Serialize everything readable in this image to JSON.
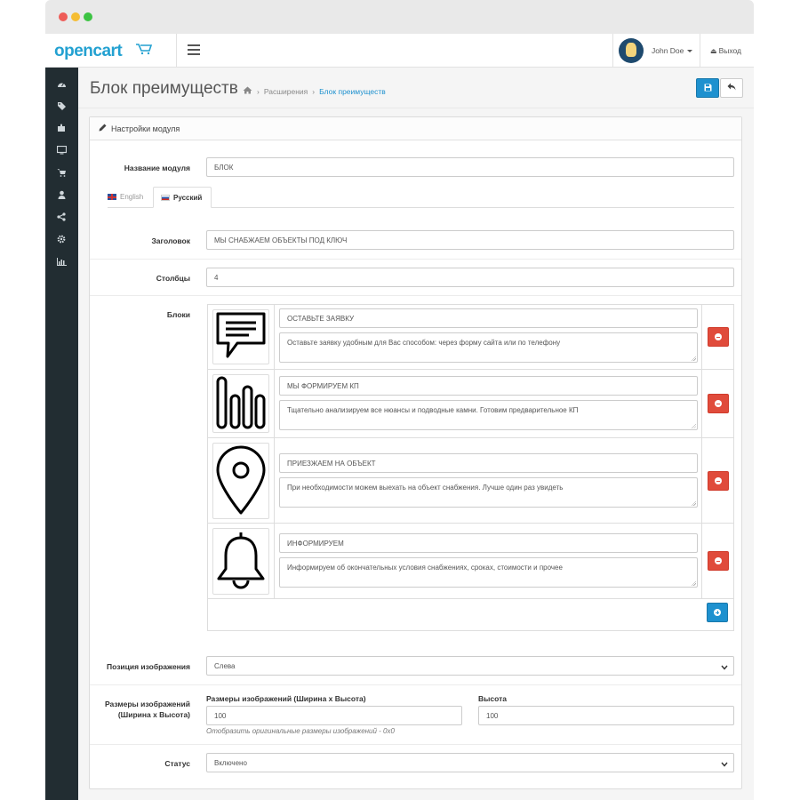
{
  "header": {
    "logo": "opencart",
    "user_name": "John Doe",
    "logout_label": "Выход"
  },
  "sidebar": {
    "icons": [
      "dashboard-icon",
      "catalog-tag-icon",
      "extensions-puzzle-icon",
      "design-monitor-icon",
      "sales-cart-icon",
      "customers-user-icon",
      "marketing-share-icon",
      "settings-gear-icon",
      "reports-chart-icon"
    ]
  },
  "page": {
    "title": "Блок преимуществ",
    "breadcrumb": [
      "Расширения",
      "Блок преимуществ"
    ]
  },
  "panel": {
    "title": "Настройки модуля"
  },
  "form": {
    "module_name_label": "Название модуля",
    "module_name_value": "БЛОК",
    "tabs": [
      {
        "label": "English",
        "active": false
      },
      {
        "label": "Русский",
        "active": true
      }
    ],
    "heading_label": "Заголовок",
    "heading_value": "МЫ СНАБЖАЕМ ОБЪЕКТЫ ПОД КЛЮЧ",
    "columns_label": "Столбцы",
    "columns_value": "4",
    "blocks_label": "Блоки",
    "blocks": [
      {
        "icon": "chat-bubble-icon",
        "title": "ОСТАВЬТЕ ЗАЯВКУ",
        "description": "Оставьте заявку удобным для Вас способом: через форму сайта или по телефону"
      },
      {
        "icon": "bars-chart-icon",
        "title": "МЫ ФОРМИРУЕМ КП",
        "description": "Тщательно анализируем все нюансы и подводные камни. Готовим предварительное КП"
      },
      {
        "icon": "map-pin-icon",
        "title": "ПРИЕЗЖАЕМ НА ОБЪЕКТ",
        "description": "При необходимости можем выехать на объект снабжения. Лучше один раз увидеть"
      },
      {
        "icon": "bell-icon",
        "title": "ИНФОРМИРУЕМ",
        "description": "Информируем об окончательных условия снабжениях, сроках, стоимости и прочее"
      }
    ],
    "image_position_label": "Позиция изображения",
    "image_position_value": "Слева",
    "image_size_label": "Размеры изображений (Ширина x Высота)",
    "image_width_label": "Размеры изображений (Ширина x Высота)",
    "image_width_value": "100",
    "image_height_label": "Высота",
    "image_height_value": "100",
    "image_size_help": "Отобразить оригинальные размеры изображений - 0x0",
    "status_label": "Статус",
    "status_value": "Включено"
  }
}
